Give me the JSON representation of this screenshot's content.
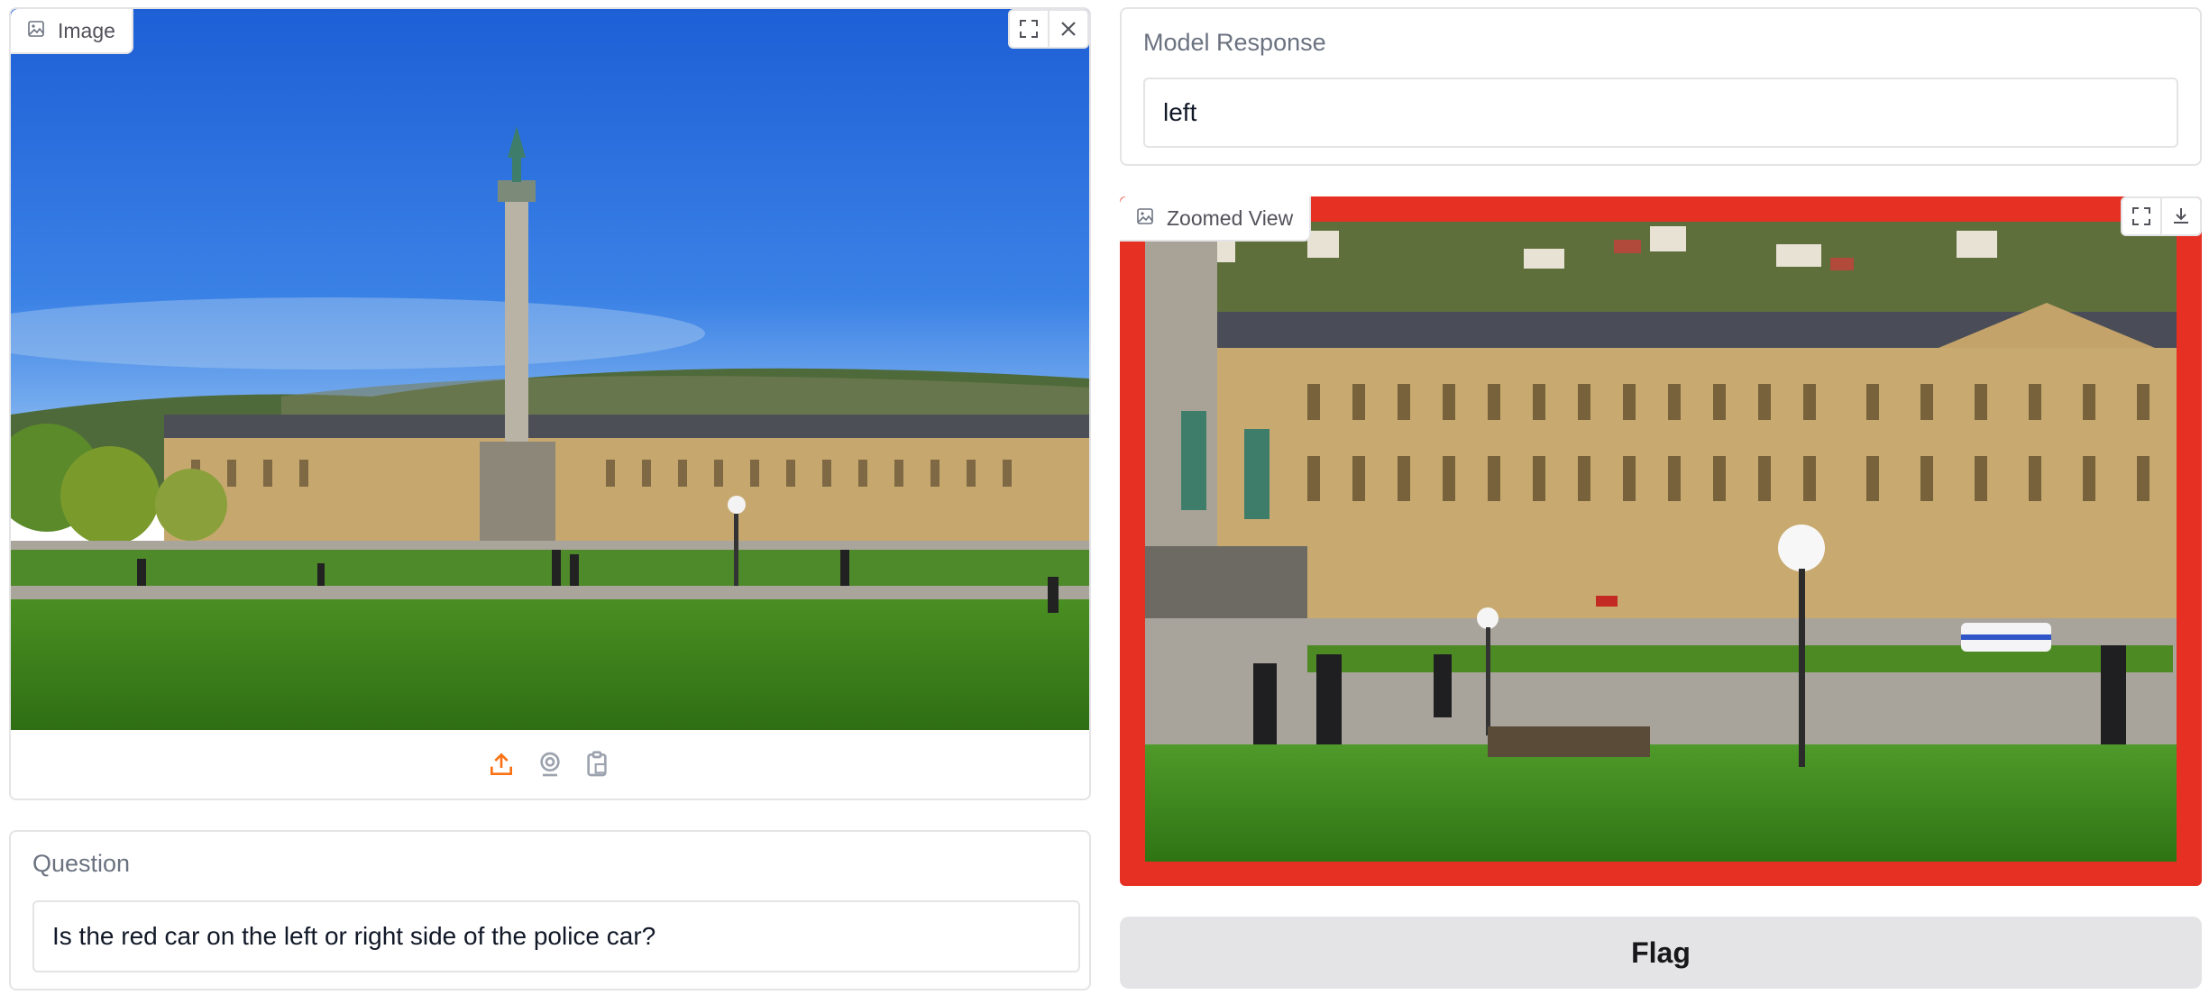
{
  "image_panel": {
    "label": "Image"
  },
  "question": {
    "label": "Question",
    "value": "Is the red car on the left or right side of the police car?"
  },
  "response": {
    "label": "Model Response",
    "value": "left"
  },
  "zoom_panel": {
    "label": "Zoomed View",
    "highlight_color": "#e63023"
  },
  "actions": {
    "flag_label": "Flag"
  },
  "icons": [
    "image-icon",
    "fullscreen-icon",
    "close-icon",
    "upload-icon",
    "webcam-icon",
    "clipboard-icon",
    "download-icon"
  ],
  "colors": {
    "accent": "#f97316",
    "border": "#e4e4e7",
    "button_bg": "#e4e4e7"
  }
}
